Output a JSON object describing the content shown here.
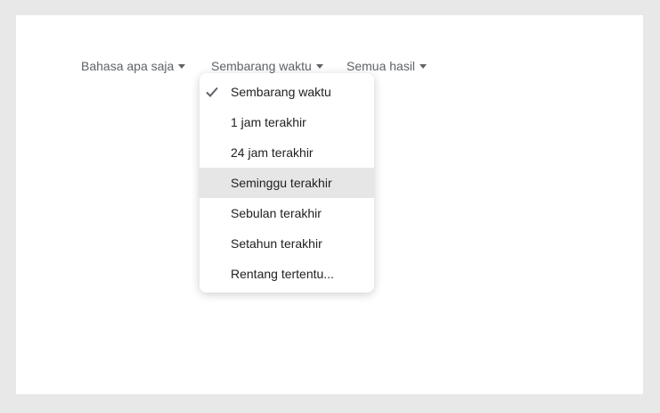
{
  "toolbar": {
    "language_label": "Bahasa apa saja",
    "time_label": "Sembarang waktu",
    "results_label": "Semua hasil"
  },
  "time_menu": {
    "items": [
      {
        "label": "Sembarang waktu",
        "selected": true,
        "highlighted": false
      },
      {
        "label": "1 jam terakhir",
        "selected": false,
        "highlighted": false
      },
      {
        "label": "24 jam terakhir",
        "selected": false,
        "highlighted": false
      },
      {
        "label": "Seminggu terakhir",
        "selected": false,
        "highlighted": true
      },
      {
        "label": "Sebulan terakhir",
        "selected": false,
        "highlighted": false
      },
      {
        "label": "Setahun terakhir",
        "selected": false,
        "highlighted": false
      },
      {
        "label": "Rentang tertentu...",
        "selected": false,
        "highlighted": false
      }
    ]
  },
  "colors": {
    "page_background": "#e8e8e8",
    "card_background": "#ffffff",
    "tool_text": "#5f6368",
    "menu_text": "#202124",
    "highlight": "#e6e6e6"
  },
  "icons": {
    "check": "check-icon",
    "caret": "caret-down-icon"
  }
}
